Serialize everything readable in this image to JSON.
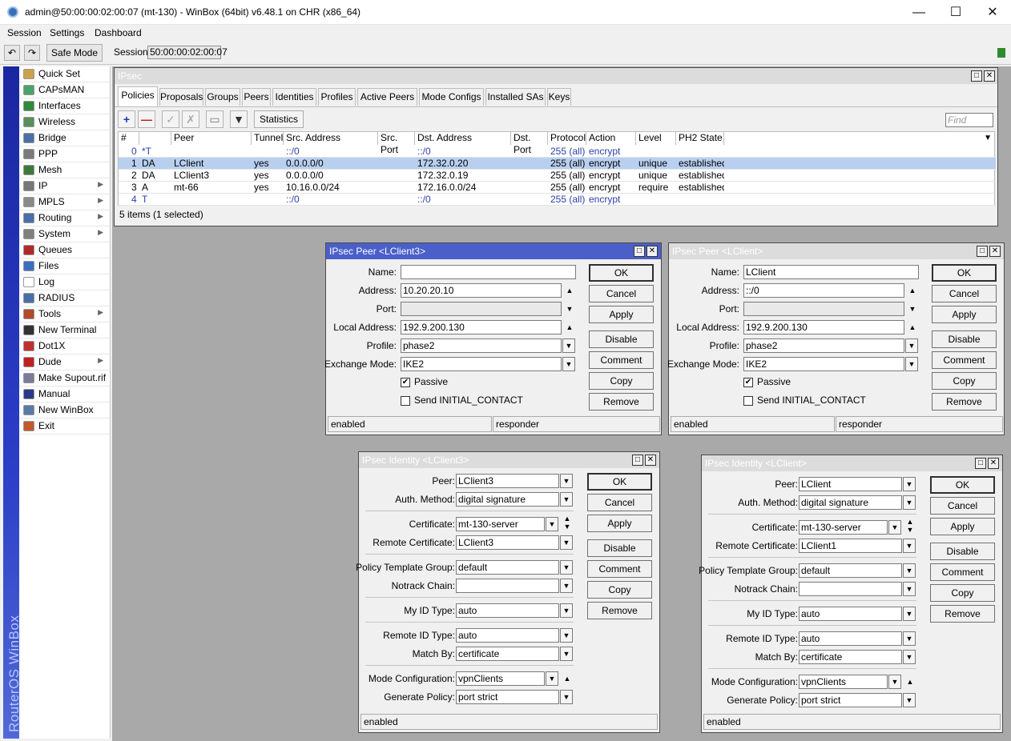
{
  "window": {
    "title": "admin@50:00:00:02:00:07 (mt-130) - WinBox (64bit) v6.48.1 on CHR (x86_64)"
  },
  "menu": [
    "Session",
    "Settings",
    "Dashboard"
  ],
  "toolbar": {
    "safe_mode": "Safe Mode",
    "session_label": "Session:",
    "session_value": "50:00:00:02:00:07"
  },
  "sidebar": {
    "brand": "RouterOS WinBox",
    "items": [
      {
        "label": "Quick Set",
        "icon": "quickset-icon",
        "color": "#c9a24a",
        "arrow": false
      },
      {
        "label": "CAPsMAN",
        "icon": "capsman-icon",
        "color": "#4aa36b",
        "arrow": false
      },
      {
        "label": "Interfaces",
        "icon": "interfaces-icon",
        "color": "#2f8a3a",
        "arrow": false
      },
      {
        "label": "Wireless",
        "icon": "wireless-icon",
        "color": "#5a8f5a",
        "arrow": false
      },
      {
        "label": "Bridge",
        "icon": "bridge-icon",
        "color": "#4a6ea8",
        "arrow": false
      },
      {
        "label": "PPP",
        "icon": "ppp-icon",
        "color": "#7a7a7a",
        "arrow": false
      },
      {
        "label": "Mesh",
        "icon": "mesh-icon",
        "color": "#3c7a3c",
        "arrow": false
      },
      {
        "label": "IP",
        "icon": "ip-icon",
        "color": "#777777",
        "arrow": true
      },
      {
        "label": "MPLS",
        "icon": "mpls-icon",
        "color": "#8a8a8a",
        "arrow": true
      },
      {
        "label": "Routing",
        "icon": "routing-icon",
        "color": "#4a6ea8",
        "arrow": true
      },
      {
        "label": "System",
        "icon": "system-icon",
        "color": "#808080",
        "arrow": true
      },
      {
        "label": "Queues",
        "icon": "queues-icon",
        "color": "#b02a2a",
        "arrow": false
      },
      {
        "label": "Files",
        "icon": "files-icon",
        "color": "#3a6fc0",
        "arrow": false
      },
      {
        "label": "Log",
        "icon": "log-icon",
        "color": "#ffffff",
        "arrow": false
      },
      {
        "label": "RADIUS",
        "icon": "radius-icon",
        "color": "#4a6ea8",
        "arrow": false
      },
      {
        "label": "Tools",
        "icon": "tools-icon",
        "color": "#b04a2a",
        "arrow": true
      },
      {
        "label": "New Terminal",
        "icon": "terminal-icon",
        "color": "#333333",
        "arrow": false
      },
      {
        "label": "Dot1X",
        "icon": "dot1x-icon",
        "color": "#c03030",
        "arrow": false
      },
      {
        "label": "Dude",
        "icon": "dude-icon",
        "color": "#c02020",
        "arrow": true
      },
      {
        "label": "Make Supout.rif",
        "icon": "supout-icon",
        "color": "#7a7a9a",
        "arrow": false
      },
      {
        "label": "Manual",
        "icon": "manual-icon",
        "color": "#2a3a8a",
        "arrow": false
      },
      {
        "label": "New WinBox",
        "icon": "winbox-icon",
        "color": "#5a7aa8",
        "arrow": false
      },
      {
        "label": "Exit",
        "icon": "exit-icon",
        "color": "#c05a2a",
        "arrow": false
      }
    ]
  },
  "ipsec": {
    "title": "IPsec",
    "tabs": [
      "Policies",
      "Proposals",
      "Groups",
      "Peers",
      "Identities",
      "Profiles",
      "Active Peers",
      "Mode Configs",
      "Installed SAs",
      "Keys"
    ],
    "statistics": "Statistics",
    "find_placeholder": "Find",
    "columns": [
      "#",
      "",
      "Peer",
      "Tunnel",
      "Src. Address",
      "Src. Port",
      "Dst. Address",
      "Dst. Port",
      "Protocol",
      "Action",
      "Level",
      "PH2 State"
    ],
    "rows": [
      [
        "0",
        "*T",
        "",
        "",
        "::/0",
        "",
        "::/0",
        "",
        "255 (all)",
        "encrypt",
        "",
        ""
      ],
      [
        "1",
        "DA",
        "LClient",
        "yes",
        "0.0.0.0/0",
        "",
        "172.32.0.20",
        "",
        "255 (all)",
        "encrypt",
        "unique",
        "established"
      ],
      [
        "2",
        "DA",
        "LClient3",
        "yes",
        "0.0.0.0/0",
        "",
        "172.32.0.19",
        "",
        "255 (all)",
        "encrypt",
        "unique",
        "established"
      ],
      [
        "3",
        "A",
        "mt-66",
        "yes",
        "10.16.0.0/24",
        "",
        "172.16.0.0/24",
        "",
        "255 (all)",
        "encrypt",
        "require",
        "established"
      ],
      [
        "4",
        "T",
        "",
        "",
        "::/0",
        "",
        "::/0",
        "",
        "255 (all)",
        "encrypt",
        "",
        ""
      ]
    ],
    "status": "5 items (1 selected)"
  },
  "peer1": {
    "title": "IPsec Peer <LClient3>",
    "labels": {
      "name": "Name:",
      "address": "Address:",
      "port": "Port:",
      "local_address": "Local Address:",
      "profile": "Profile:",
      "exchange_mode": "Exchange Mode:"
    },
    "name": "LClient3",
    "address": "10.20.20.10",
    "port": "",
    "local_address": "192.9.200.130",
    "profile": "phase2",
    "exchange_mode": "IKE2",
    "passive": "Passive",
    "send_initial": "Send INITIAL_CONTACT",
    "buttons": [
      "OK",
      "Cancel",
      "Apply",
      "Disable",
      "Comment",
      "Copy",
      "Remove"
    ],
    "status_left": "enabled",
    "status_right": "responder"
  },
  "peer2": {
    "title": "IPsec Peer <LClient>",
    "labels": {
      "name": "Name:",
      "address": "Address:",
      "port": "Port:",
      "local_address": "Local Address:",
      "profile": "Profile:",
      "exchange_mode": "Exchange Mode:"
    },
    "name": "LClient",
    "address": "::/0",
    "port": "",
    "local_address": "192.9.200.130",
    "profile": "phase2",
    "exchange_mode": "IKE2",
    "passive": "Passive",
    "send_initial": "Send INITIAL_CONTACT",
    "buttons": [
      "OK",
      "Cancel",
      "Apply",
      "Disable",
      "Comment",
      "Copy",
      "Remove"
    ],
    "status_left": "enabled",
    "status_right": "responder"
  },
  "ident1": {
    "title": "IPsec Identity <LClient3>",
    "labels": {
      "peer": "Peer:",
      "auth": "Auth. Method:",
      "cert": "Certificate:",
      "rcert": "Remote Certificate:",
      "ptg": "Policy Template Group:",
      "notrack": "Notrack Chain:",
      "myid": "My ID Type:",
      "remid": "Remote ID Type:",
      "match": "Match By:",
      "modecfg": "Mode Configuration:",
      "genpol": "Generate Policy:"
    },
    "peer": "LClient3",
    "auth": "digital signature",
    "cert": "mt-130-server",
    "rcert": "LClient3",
    "ptg": "default",
    "notrack": "",
    "myid": "auto",
    "remid": "auto",
    "match": "certificate",
    "modecfg": "vpnClients",
    "genpol": "port strict",
    "buttons": [
      "OK",
      "Cancel",
      "Apply",
      "Disable",
      "Comment",
      "Copy",
      "Remove"
    ],
    "status": "enabled"
  },
  "ident2": {
    "title": "IPsec Identity <LClient>",
    "labels": {
      "peer": "Peer:",
      "auth": "Auth. Method:",
      "cert": "Certificate:",
      "rcert": "Remote Certificate:",
      "ptg": "Policy Template Group:",
      "notrack": "Notrack Chain:",
      "myid": "My ID Type:",
      "remid": "Remote ID Type:",
      "match": "Match By:",
      "modecfg": "Mode Configuration:",
      "genpol": "Generate Policy:"
    },
    "peer": "LClient",
    "auth": "digital signature",
    "cert": "mt-130-server",
    "rcert": "LClient1",
    "ptg": "default",
    "notrack": "",
    "myid": "auto",
    "remid": "auto",
    "match": "certificate",
    "modecfg": "vpnClients",
    "genpol": "port strict",
    "buttons": [
      "OK",
      "Cancel",
      "Apply",
      "Disable",
      "Comment",
      "Copy",
      "Remove"
    ],
    "status": "enabled"
  }
}
